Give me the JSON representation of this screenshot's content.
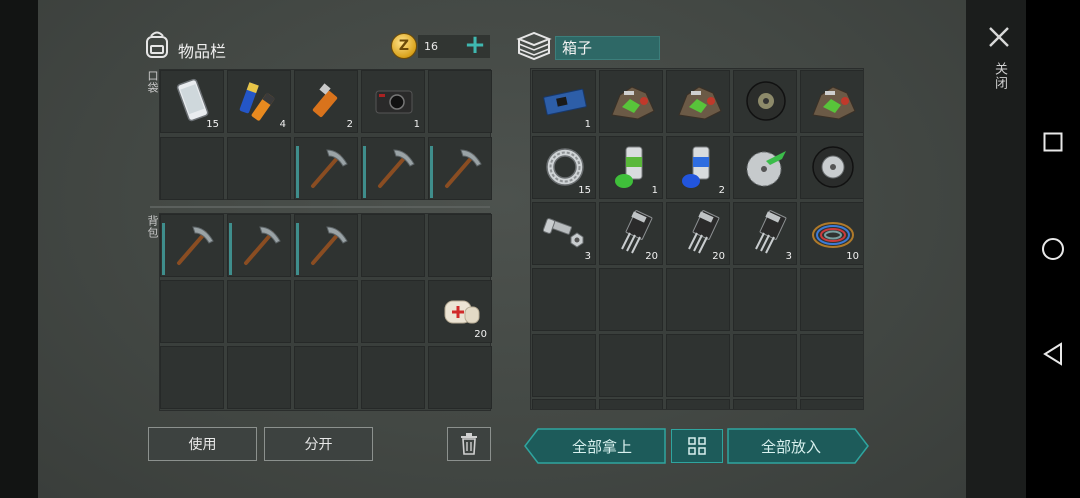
{
  "inventory": {
    "title": "物品栏",
    "coins": "16",
    "pocket_label": "口袋",
    "backpack_label": "背包"
  },
  "box": {
    "title": "箱子"
  },
  "pocket": [
    [
      {
        "item": "smartphone-icon",
        "qty": "15"
      },
      {
        "item": "batteries-icon",
        "qty": "4"
      },
      {
        "item": "usb-drive-icon",
        "qty": "2"
      },
      {
        "item": "camera-icon",
        "qty": "1"
      },
      {
        "item": "",
        "qty": ""
      }
    ],
    [
      {
        "item": "",
        "qty": ""
      },
      {
        "item": "",
        "qty": ""
      },
      {
        "item": "pickaxe-icon",
        "qty": ""
      },
      {
        "item": "pickaxe-icon",
        "qty": ""
      },
      {
        "item": "pickaxe-icon",
        "qty": ""
      }
    ]
  ],
  "backpack": [
    [
      {
        "item": "pickaxe-icon",
        "qty": ""
      },
      {
        "item": "pickaxe-icon",
        "qty": ""
      },
      {
        "item": "pickaxe-icon",
        "qty": ""
      },
      {
        "item": "",
        "qty": ""
      },
      {
        "item": "",
        "qty": ""
      }
    ],
    [
      {
        "item": "",
        "qty": ""
      },
      {
        "item": "",
        "qty": ""
      },
      {
        "item": "",
        "qty": ""
      },
      {
        "item": "",
        "qty": ""
      },
      {
        "item": "bandage-icon",
        "qty": "20"
      }
    ],
    [
      {
        "item": "",
        "qty": ""
      },
      {
        "item": "",
        "qty": ""
      },
      {
        "item": "",
        "qty": ""
      },
      {
        "item": "",
        "qty": ""
      },
      {
        "item": "",
        "qty": ""
      }
    ]
  ],
  "box_items": [
    [
      {
        "item": "circuit-board-icon",
        "qty": "1"
      },
      {
        "item": "scrap-parts-icon",
        "qty": ""
      },
      {
        "item": "scrap-parts-icon",
        "qty": ""
      },
      {
        "item": "tire-icon",
        "qty": ""
      },
      {
        "item": "scrap-parts-icon",
        "qty": ""
      }
    ],
    [
      {
        "item": "bearing-icon",
        "qty": "15"
      },
      {
        "item": "green-spray-paint-icon",
        "qty": "1"
      },
      {
        "item": "blue-spray-paint-icon",
        "qty": "2"
      },
      {
        "item": "saw-blade-icon",
        "qty": ""
      },
      {
        "item": "wheel-icon",
        "qty": ""
      }
    ],
    [
      {
        "item": "bolt-nut-icon",
        "qty": "3"
      },
      {
        "item": "transistor-icon",
        "qty": "20"
      },
      {
        "item": "transistor-icon",
        "qty": "20"
      },
      {
        "item": "transistor-icon",
        "qty": "3"
      },
      {
        "item": "wire-coil-icon",
        "qty": "10"
      }
    ],
    [
      {
        "item": "",
        "qty": ""
      },
      {
        "item": "",
        "qty": ""
      },
      {
        "item": "",
        "qty": ""
      },
      {
        "item": "",
        "qty": ""
      },
      {
        "item": "",
        "qty": ""
      }
    ],
    [
      {
        "item": "",
        "qty": ""
      },
      {
        "item": "",
        "qty": ""
      },
      {
        "item": "",
        "qty": ""
      },
      {
        "item": "",
        "qty": ""
      },
      {
        "item": "",
        "qty": ""
      }
    ]
  ],
  "buttons": {
    "use": "使用",
    "split": "分开",
    "take_all": "全部拿上",
    "put_all": "全部放入",
    "close": "关闭"
  },
  "colors": {
    "accent": "#1d5b5a",
    "durability": "#3f8e8c",
    "slot_bg": "#2f3331"
  }
}
